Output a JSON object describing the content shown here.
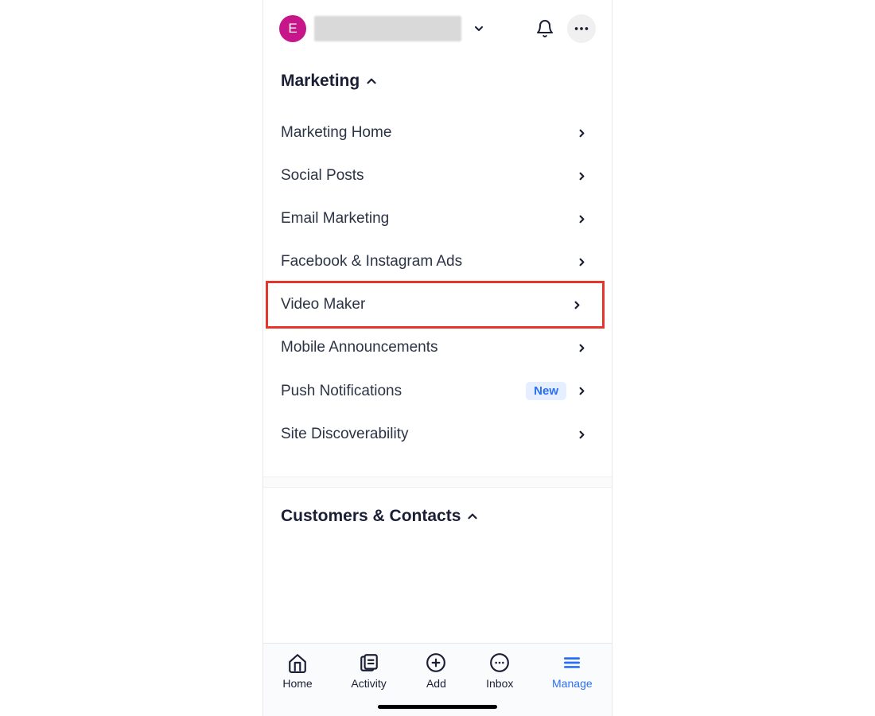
{
  "header": {
    "avatar_initial": "E"
  },
  "section1": {
    "title": "Marketing",
    "items": [
      {
        "label": "Marketing Home"
      },
      {
        "label": "Social Posts"
      },
      {
        "label": "Email Marketing"
      },
      {
        "label": "Facebook & Instagram Ads"
      },
      {
        "label": "Video Maker"
      },
      {
        "label": "Mobile Announcements"
      },
      {
        "label": "Push Notifications",
        "badge": "New"
      },
      {
        "label": "Site Discoverability"
      }
    ]
  },
  "section2": {
    "title": "Customers & Contacts"
  },
  "nav": {
    "home": "Home",
    "activity": "Activity",
    "add": "Add",
    "inbox": "Inbox",
    "manage": "Manage"
  }
}
